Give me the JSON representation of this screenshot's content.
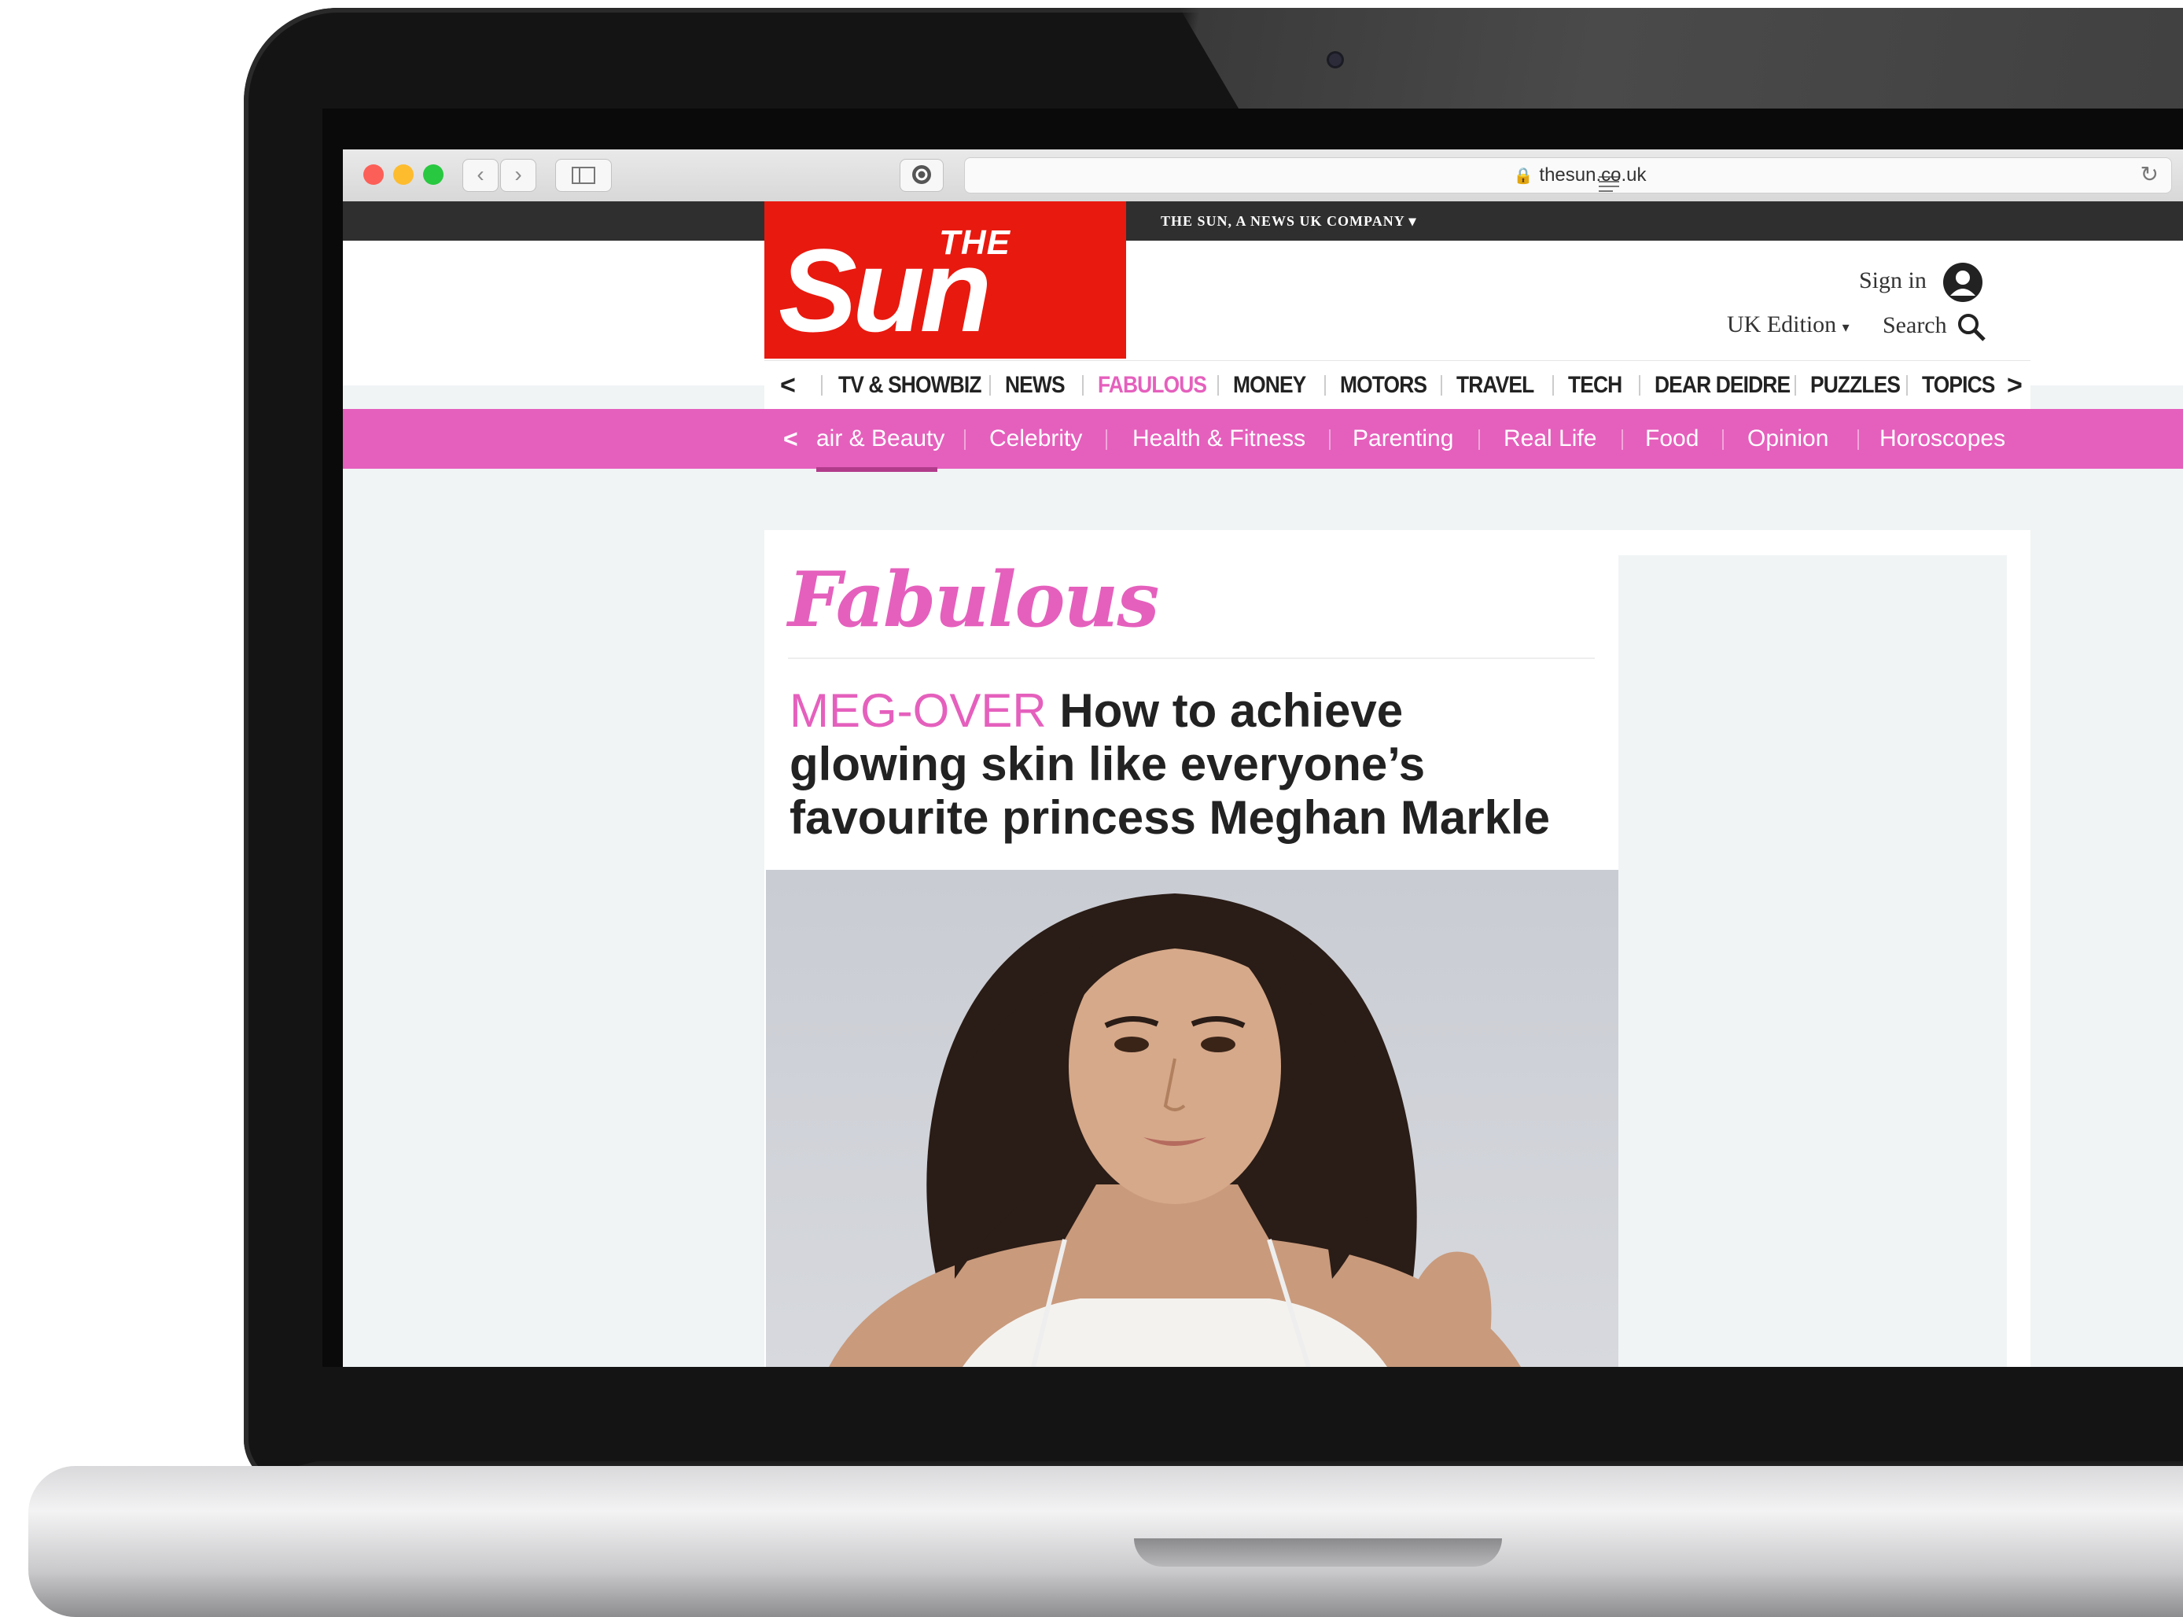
{
  "browser": {
    "url": "thesun.co.uk"
  },
  "site": {
    "company_bar": "THE SUN, A NEWS UK COMPANY",
    "logo_the": "THE",
    "logo_sun": "Sun",
    "sign_in": "Sign in",
    "edition": "UK Edition",
    "search": "Search"
  },
  "nav": {
    "items": [
      "TV & SHOWBIZ",
      "NEWS",
      "FABULOUS",
      "MONEY",
      "MOTORS",
      "TRAVEL",
      "TECH",
      "DEAR DEIDRE",
      "PUZZLES",
      "TOPICS"
    ],
    "active": "FABULOUS"
  },
  "subnav": {
    "items": [
      "air & Beauty",
      "Celebrity",
      "Health & Fitness",
      "Parenting",
      "Real Life",
      "Food",
      "Opinion",
      "Horoscopes"
    ]
  },
  "article": {
    "section": "Fabulous",
    "kicker": "MEG-OVER",
    "headline": "How to achieve glowing skin like everyone’s favourite princess Meghan Markle"
  },
  "colors": {
    "sun_red": "#e8190f",
    "fabulous_pink": "#e560bd",
    "topbar_dark": "#2f2f2f"
  }
}
